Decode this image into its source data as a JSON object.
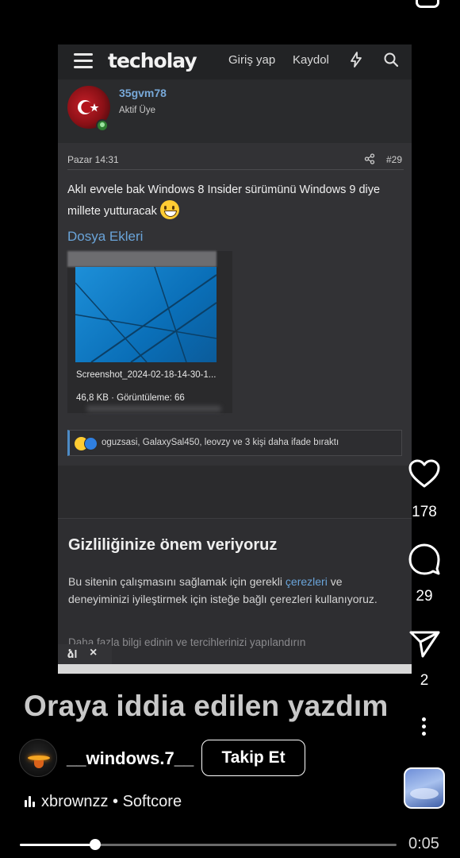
{
  "forum": {
    "logo": "techolay",
    "nav_login": "Giriş yap",
    "nav_register": "Kaydol",
    "author_name": "35gvm78",
    "author_role": "Aktif Üye",
    "post_date": "Pazar 14:31",
    "post_number": "#29",
    "post_text": "Aklı evvele bak Windows 8 Insider sürümünü Windows 9 diye millete yutturacak",
    "attachments_title": "Dosya Ekleri",
    "attachment_name": "Screenshot_2024-02-18-14-30-1...",
    "attachment_meta": "46,8 KB · Görüntüleme: 66",
    "reactions_text": "oguzsasi, GalaxySal450, leovzy ve 3 kişi daha ifade bıraktı",
    "cookie_title": "Gizliliğinize önem veriyoruz",
    "cookie_body_1": "Bu sitenin çalışmasını sağlamak için gerekli ",
    "cookie_link": "çerezleri",
    "cookie_body_2": " ve deneyiminizi iyileştirmek için isteğe bağlı çerezleri kullanıyoruz.",
    "cookie_more": "Daha fazla bilgi edinin ve tercihlerinizi yapılandırın",
    "corner_logo": "ձl",
    "corner_close": "×"
  },
  "reel": {
    "likes": "178",
    "comments": "29",
    "shares": "2",
    "caption_overlay": "Oraya iddia edilen yazdım",
    "channel_name": "__windows.7__",
    "follow_label": "Takip Et",
    "music": "xbrownzz • Softcore",
    "time": "0:05",
    "progress": 0.2
  },
  "icons": [
    "camera-icon",
    "menu-icon",
    "bolt-icon",
    "search-icon",
    "share-icon",
    "heart-icon",
    "comment-icon",
    "send-icon",
    "more-icon",
    "music-bars-icon"
  ],
  "colors": {
    "link_blue": "#6aa4d9",
    "username_blue": "#78a9d9",
    "online_green": "#2e7d32"
  }
}
